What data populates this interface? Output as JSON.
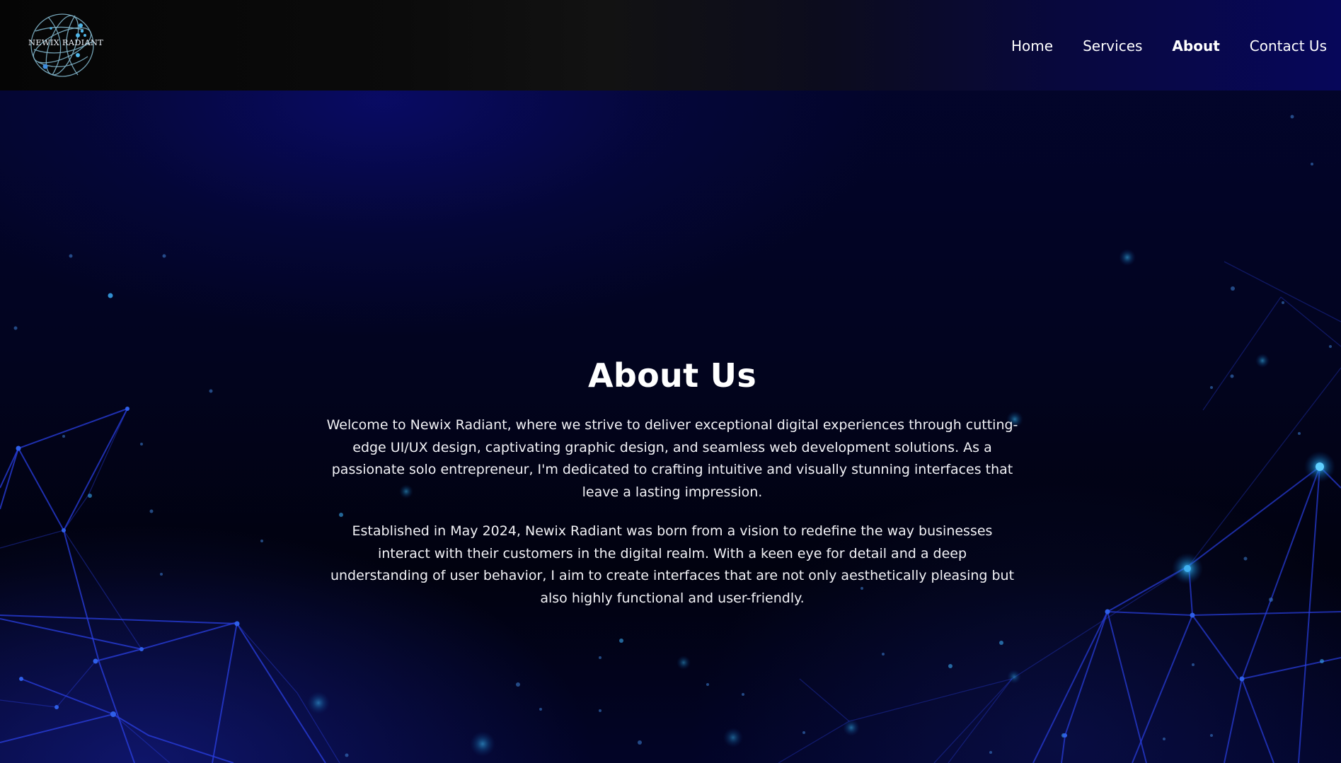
{
  "header": {
    "logo": {
      "text": "NEWIX RADIANT",
      "icon": "globe-network-logo"
    },
    "nav": [
      {
        "label": "Home",
        "active": false
      },
      {
        "label": "Services",
        "active": false
      },
      {
        "label": "About",
        "active": true
      },
      {
        "label": "Contact Us",
        "active": false
      }
    ]
  },
  "main": {
    "title": "About Us",
    "paragraphs": [
      "Welcome to Newix Radiant, where we strive to deliver exceptional digital experiences through cutting-edge UI/UX design, captivating graphic design, and seamless web development solutions. As a passionate solo entrepreneur, I'm dedicated to crafting intuitive and visually stunning interfaces that leave a lasting impression.",
      "Established in May 2024, Newix Radiant was born from a vision to redefine the way businesses interact with their customers in the digital realm. With a keen eye for detail and a deep understanding of user behavior, I aim to create interfaces that are not only aesthetically pleasing but also highly functional and user-friendly."
    ]
  },
  "colors": {
    "background_dark": "#02031a",
    "accent_blue": "#1b2fd8",
    "node_cyan": "#29a9e8",
    "text": "#ffffff"
  },
  "background": {
    "decoration": "plexus-network-lines"
  }
}
